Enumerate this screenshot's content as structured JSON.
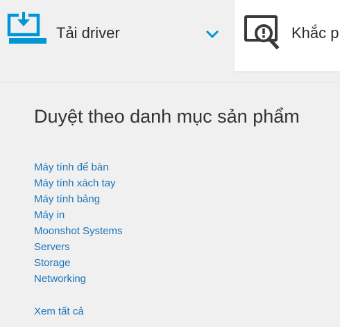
{
  "tabs": {
    "driver": {
      "label": "Tải driver",
      "icon": "download-laptop-icon",
      "expand_icon": "chevron-down-icon"
    },
    "support": {
      "label": "Khắc p",
      "icon": "search-diagnose-icon"
    }
  },
  "browse": {
    "title": "Duyệt theo danh mục sản phẩm",
    "categories": [
      "Máy tính để bàn",
      "Máy tính xách tay",
      "Máy tính bảng",
      "Máy in",
      "Moonshot Systems",
      "Servers",
      "Storage",
      "Networking"
    ],
    "see_all": "Xem tất cả"
  },
  "colors": {
    "accent": "#0096d6",
    "link": "#1a73b8",
    "panel_bg": "#f0f0f0",
    "text": "#333333"
  }
}
